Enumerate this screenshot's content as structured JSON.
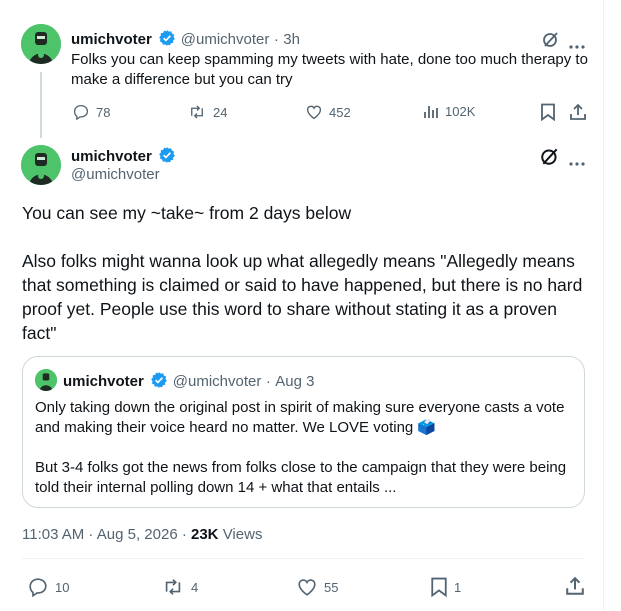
{
  "reply_tweet": {
    "name": "umichvoter",
    "handle": "@umichvoter",
    "time": "3h",
    "text": "Folks you can keep spamming my tweets with hate, done too much therapy to make a difference but you can try",
    "replies": "78",
    "reposts": "24",
    "likes": "452",
    "views": "102K"
  },
  "main_tweet": {
    "name": "umichvoter",
    "handle": "@umichvoter",
    "paragraph1": "You can see my ~take~ from 2 days below",
    "paragraph2": "Also folks might wanna look up what allegedly means \"Allegedly means that something is claimed or said to have happened, but there is no hard proof yet. People use this word to share without stating it as a proven fact\"",
    "timestamp": "11:03 AM · Aug 5, 2026 · ",
    "views_count": "23K",
    "views_label": " Views",
    "replies": "10",
    "reposts": "4",
    "likes": "55",
    "bookmarks": "1"
  },
  "quoted_tweet": {
    "name": "umichvoter",
    "handle": "@umichvoter",
    "date": "Aug 3",
    "paragraph1": "Only taking down the original post in spirit of making sure everyone casts a vote and making their voice heard no matter. We LOVE voting 🗳️",
    "paragraph2": "But 3-4 folks got the news from folks close to the campaign that they were being told their internal polling down 14 + what that entails ..."
  },
  "colors": {
    "verified": "#1d9bf0",
    "muted": "#536471",
    "avatar": "#4ec46a"
  },
  "icons": [
    "verified-badge-icon",
    "grok-icon",
    "more-icon",
    "reply-icon",
    "repost-icon",
    "like-icon",
    "views-icon",
    "bookmark-icon",
    "share-icon"
  ]
}
